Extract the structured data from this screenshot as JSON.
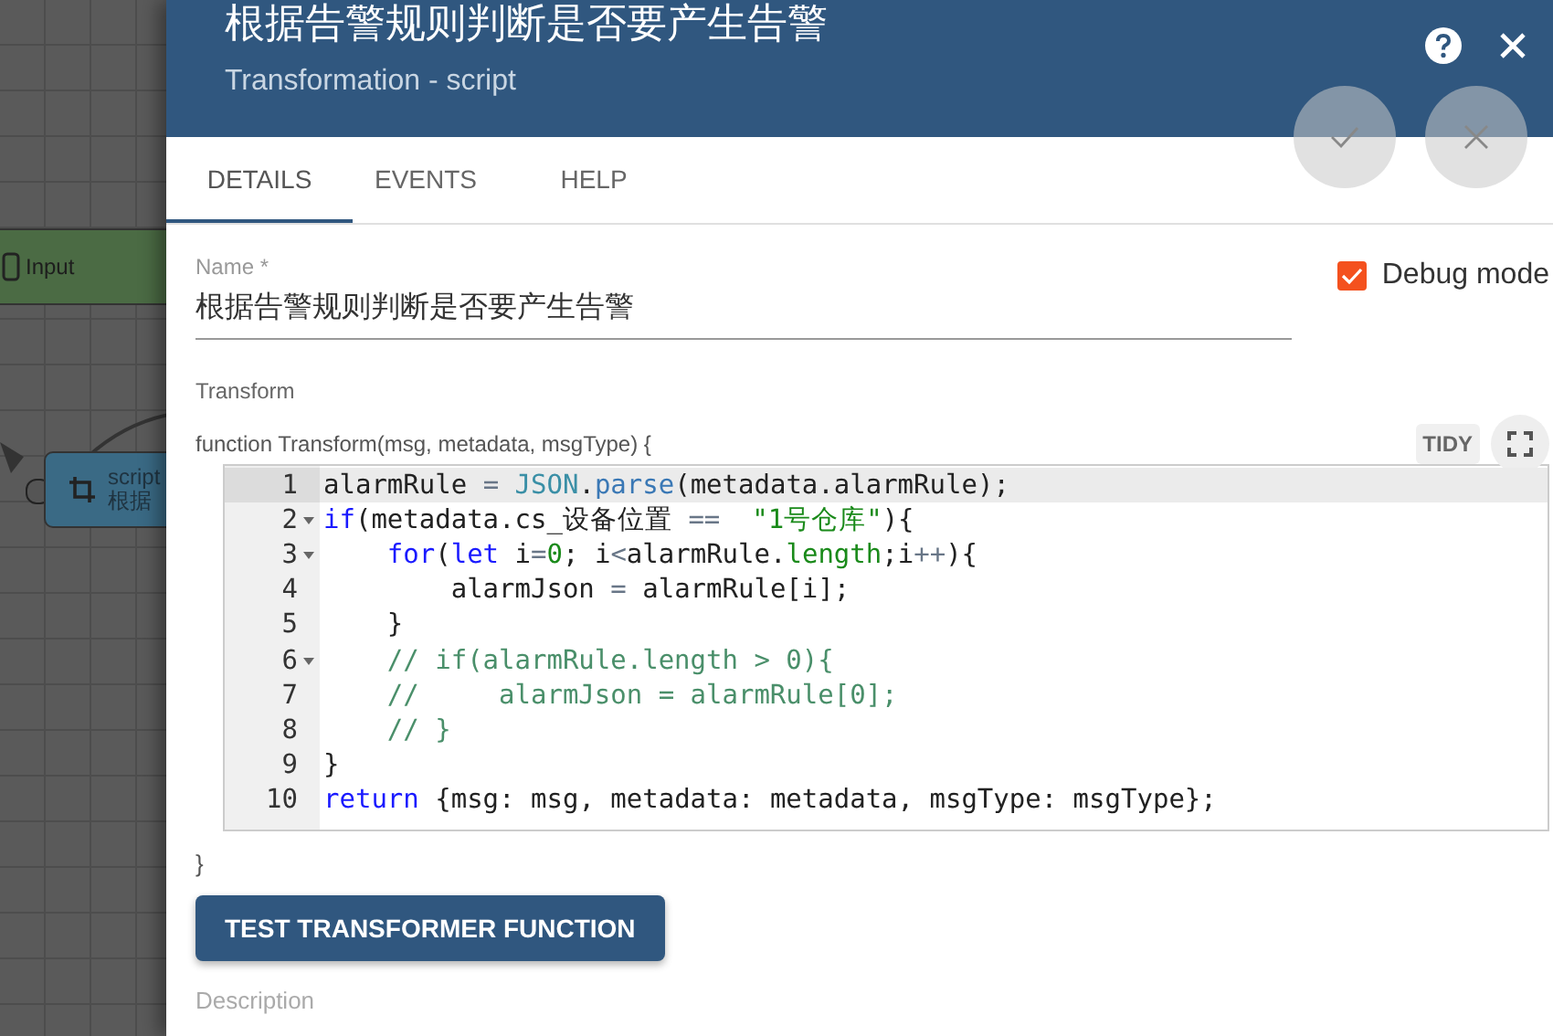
{
  "canvas": {
    "nodes": [
      {
        "kind": "input",
        "label": "Input"
      },
      {
        "kind": "script",
        "type": "script",
        "label": "根据"
      }
    ]
  },
  "dialog": {
    "title": "根据告警规则判断是否要产生告警",
    "subtitle": "Transformation - script",
    "tabs": [
      {
        "label": "DETAILS",
        "selected": true
      },
      {
        "label": "EVENTS",
        "selected": false
      },
      {
        "label": "HELP",
        "selected": false
      }
    ],
    "name_field": {
      "label": "Name *",
      "value": "根据告警规则判断是否要产生告警"
    },
    "debug_mode": {
      "label": "Debug mode",
      "checked": true
    },
    "transform": {
      "label": "Transform",
      "header": "function Transform(msg, metadata, msgType) {",
      "tidy_button": "TIDY",
      "lines": [
        {
          "number": "1",
          "foldable": false,
          "active": true,
          "tokens": [
            {
              "kind": "plain",
              "text": "alarmRule "
            },
            {
              "kind": "op",
              "text": "="
            },
            {
              "kind": "builtin",
              "text": " JSON"
            },
            {
              "kind": "plain",
              "text": "."
            },
            {
              "kind": "func",
              "text": "parse"
            },
            {
              "kind": "plain",
              "text": "(metadata.alarmRule);"
            }
          ]
        },
        {
          "number": "2",
          "foldable": true,
          "active": false,
          "tokens": [
            {
              "kind": "keyword",
              "text": "if"
            },
            {
              "kind": "plain",
              "text": "(metadata.cs_设备位置 "
            },
            {
              "kind": "op",
              "text": "=="
            },
            {
              "kind": "string",
              "text": "  \"1号仓库\""
            },
            {
              "kind": "plain",
              "text": "){"
            }
          ]
        },
        {
          "number": "3",
          "foldable": true,
          "active": false,
          "tokens": [
            {
              "kind": "keyword",
              "text": "    for"
            },
            {
              "kind": "plain",
              "text": "("
            },
            {
              "kind": "keyword",
              "text": "let"
            },
            {
              "kind": "plain",
              "text": " i"
            },
            {
              "kind": "op",
              "text": "="
            },
            {
              "kind": "number",
              "text": "0"
            },
            {
              "kind": "plain",
              "text": "; i"
            },
            {
              "kind": "op",
              "text": "<"
            },
            {
              "kind": "plain",
              "text": "alarmRule."
            },
            {
              "kind": "prop",
              "text": "length"
            },
            {
              "kind": "plain",
              "text": ";i"
            },
            {
              "kind": "op",
              "text": "++"
            },
            {
              "kind": "plain",
              "text": "){"
            }
          ]
        },
        {
          "number": "4",
          "foldable": false,
          "active": false,
          "tokens": [
            {
              "kind": "plain",
              "text": "        alarmJson "
            },
            {
              "kind": "op",
              "text": "="
            },
            {
              "kind": "plain",
              "text": " alarmRule[i];"
            }
          ]
        },
        {
          "number": "5",
          "foldable": false,
          "active": false,
          "tokens": [
            {
              "kind": "plain",
              "text": "    }"
            }
          ]
        },
        {
          "number": "6",
          "foldable": true,
          "active": false,
          "tokens": [
            {
              "kind": "comment",
              "text": "    // if(alarmRule.length > 0){"
            }
          ]
        },
        {
          "number": "7",
          "foldable": false,
          "active": false,
          "tokens": [
            {
              "kind": "comment",
              "text": "    //     alarmJson = alarmRule[0];"
            }
          ]
        },
        {
          "number": "8",
          "foldable": false,
          "active": false,
          "tokens": [
            {
              "kind": "comment",
              "text": "    // }"
            }
          ]
        },
        {
          "number": "9",
          "foldable": false,
          "active": false,
          "tokens": [
            {
              "kind": "plain",
              "text": "}"
            }
          ]
        },
        {
          "number": "10",
          "foldable": false,
          "active": false,
          "tokens": [
            {
              "kind": "keyword",
              "text": "return"
            },
            {
              "kind": "plain",
              "text": " {msg: msg, metadata: metadata, msgType: msgType};"
            }
          ]
        }
      ],
      "footer": "}"
    },
    "test_button": "TEST TRANSFORMER FUNCTION",
    "description_label": "Description"
  }
}
